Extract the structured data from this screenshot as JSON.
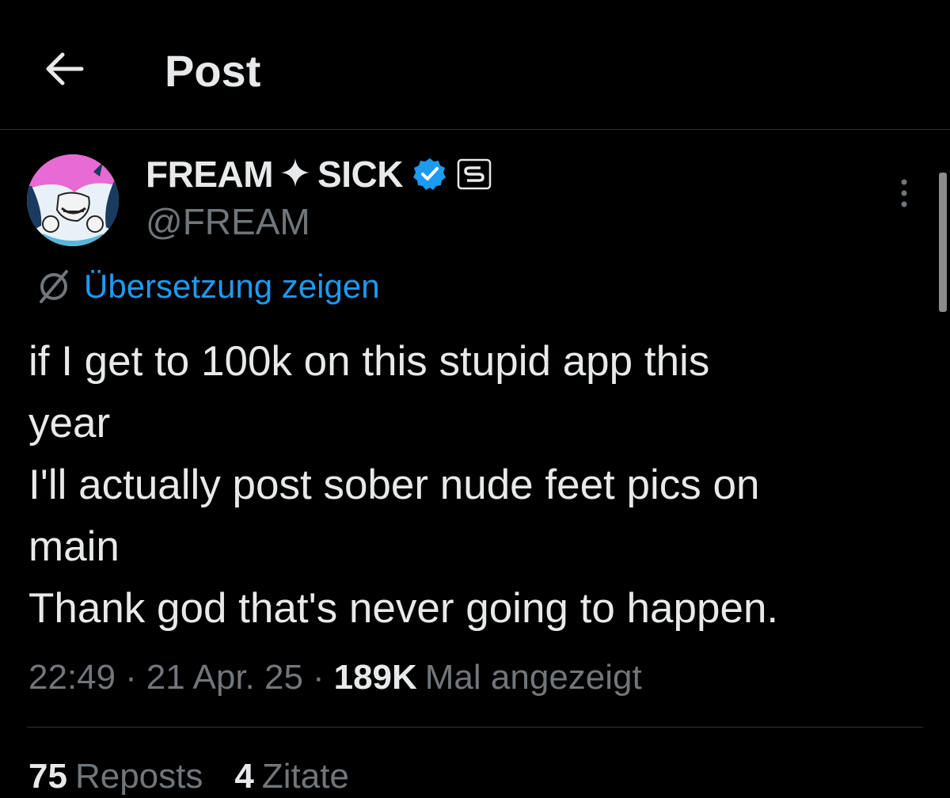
{
  "header": {
    "title": "Post"
  },
  "author": {
    "display_name_part1": "FREAM",
    "display_name_part2": "SICK",
    "handle": "@FREAM"
  },
  "translate": {
    "label": "Übersetzung zeigen"
  },
  "tweet": {
    "lines": [
      "if I get to 100k on this stupid app this",
      "year",
      "I'll actually post sober nude feet pics on",
      "main",
      "Thank god that's never going to happen."
    ]
  },
  "meta": {
    "time": "22:49",
    "date": "21 Apr. 25",
    "views_count": "189K",
    "views_label": "Mal angezeigt"
  },
  "stats": {
    "reposts_count": "75",
    "reposts_label": "Reposts",
    "quotes_count": "4",
    "quotes_label": "Zitate"
  },
  "colors": {
    "background": "#000000",
    "text": "#e7e9ea",
    "muted": "#71767b",
    "accent": "#1d9bf0",
    "divider": "#2f3336"
  },
  "icons": {
    "back": "arrow-left-icon",
    "verified": "verified-badge-icon",
    "affiliate": "affiliate-badge-icon",
    "more": "more-vertical-icon",
    "translate": "globe-translate-icon",
    "sparkle": "sparkle-icon"
  }
}
